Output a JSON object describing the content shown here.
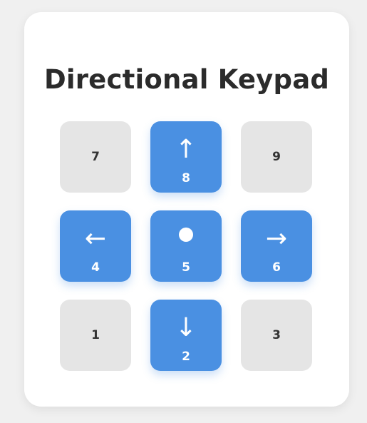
{
  "title": "Directional Keypad",
  "colors": {
    "active": "#4a90e2",
    "inactive": "#e5e5e5",
    "card": "#ffffff",
    "background": "#f0f0f0"
  },
  "keys": [
    {
      "number": "7",
      "active": false
    },
    {
      "number": "8",
      "active": true,
      "icon": "arrow-up-icon",
      "glyph": "↑"
    },
    {
      "number": "9",
      "active": false
    },
    {
      "number": "4",
      "active": true,
      "icon": "arrow-left-icon",
      "glyph": "←"
    },
    {
      "number": "5",
      "active": true,
      "icon": "center-dot-icon"
    },
    {
      "number": "6",
      "active": true,
      "icon": "arrow-right-icon",
      "glyph": "→"
    },
    {
      "number": "1",
      "active": false
    },
    {
      "number": "2",
      "active": true,
      "icon": "arrow-down-icon",
      "glyph": "↓"
    },
    {
      "number": "3",
      "active": false
    }
  ]
}
